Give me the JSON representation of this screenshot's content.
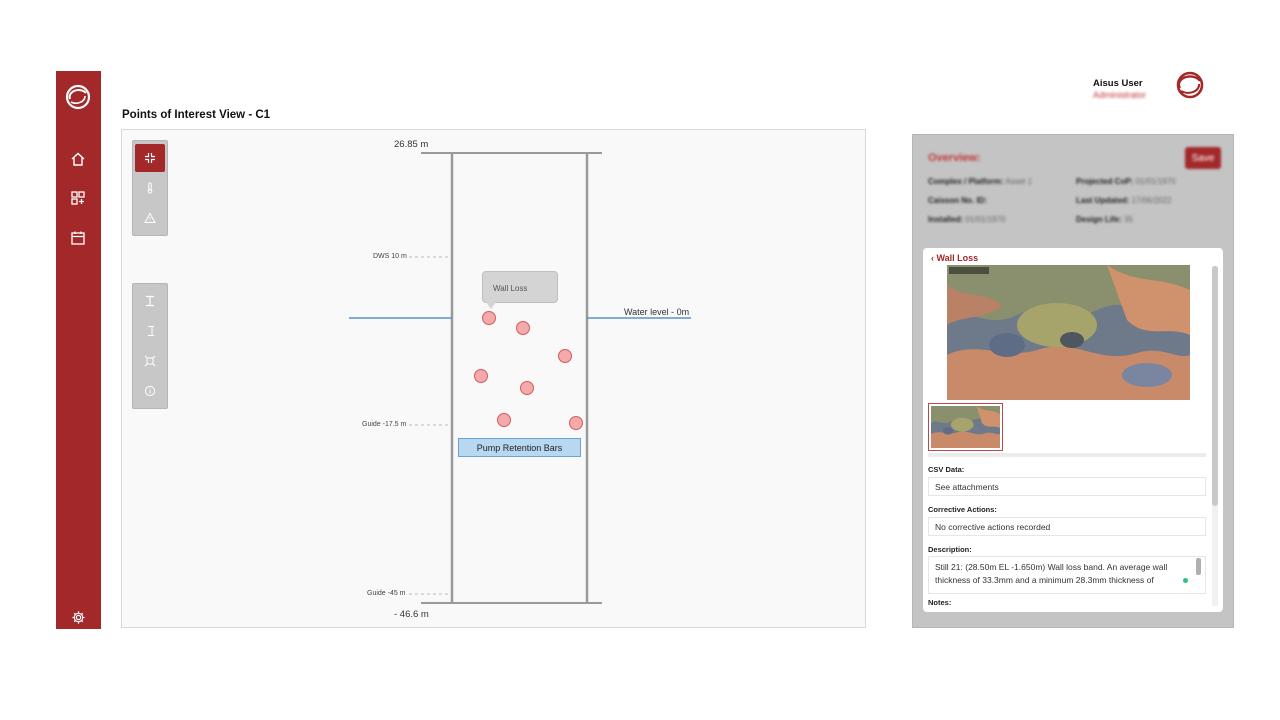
{
  "sidebar": {
    "logo_icon": "ring-logo-icon",
    "items": [
      {
        "icon": "home-icon"
      },
      {
        "icon": "dashboard-add-icon"
      },
      {
        "icon": "calendar-icon"
      }
    ],
    "settings_icon": "gear-icon",
    "color": "#a3282a"
  },
  "header": {
    "user_name": "Aisus User",
    "user_role": "Administrator"
  },
  "page": {
    "title": "Points of Interest View - C1"
  },
  "toolbox": {
    "top_tools": [
      "collapse-icon",
      "thermometer-icon",
      "warning-icon"
    ],
    "bottom_tools": [
      "beam-icon",
      "column-icon",
      "frame-icon",
      "info-icon"
    ]
  },
  "diagram": {
    "top_elevation": "26.85 m",
    "bottom_elevation": "- 46.6 m",
    "dws_label": "DWS 10 m",
    "guide_upper_label": "Guide -17.5 m",
    "guide_lower_label": "Guide -45 m",
    "water_level_label": "Water level - 0m",
    "tooltip_label": "Wall Loss",
    "pump_bar_label": "Pump Retention Bars",
    "poi_color": "#f4a9ab",
    "water_line_color": "#5b8fd0"
  },
  "overview": {
    "title": "Overview:",
    "save_label": "Save",
    "fields": [
      {
        "label": "Complex / Platform:",
        "value": "Asset 1"
      },
      {
        "label": "Projected CoP:",
        "value": "01/01/1970"
      },
      {
        "label": "Caisson No. ID:",
        "value": ""
      },
      {
        "label": "Last Updated:",
        "value": "17/06/2022"
      },
      {
        "label": "Installed:",
        "value": "01/01/1970"
      },
      {
        "label": "Design Life:",
        "value": "35"
      }
    ]
  },
  "detail": {
    "back_label": "Wall Loss",
    "csv_label": "CSV Data:",
    "csv_value": "See attachments",
    "corrective_label": "Corrective Actions:",
    "corrective_value": "No corrective actions recorded",
    "description_label": "Description:",
    "description_value": "Still 21: (28.50m EL -1.650m) Wall loss band. An average wall thickness of 33.3mm and a minimum 28.3mm thickness of",
    "notes_label": "Notes:"
  }
}
